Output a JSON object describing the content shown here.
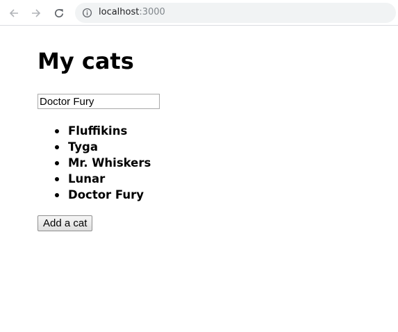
{
  "browser": {
    "url_host": "localhost",
    "url_port": ":3000"
  },
  "page": {
    "title": "My cats",
    "input_value": "Doctor Fury",
    "cats": [
      "Fluffikins",
      "Tyga",
      "Mr. Whiskers",
      "Lunar",
      "Doctor Fury"
    ],
    "add_button_label": "Add a cat"
  }
}
